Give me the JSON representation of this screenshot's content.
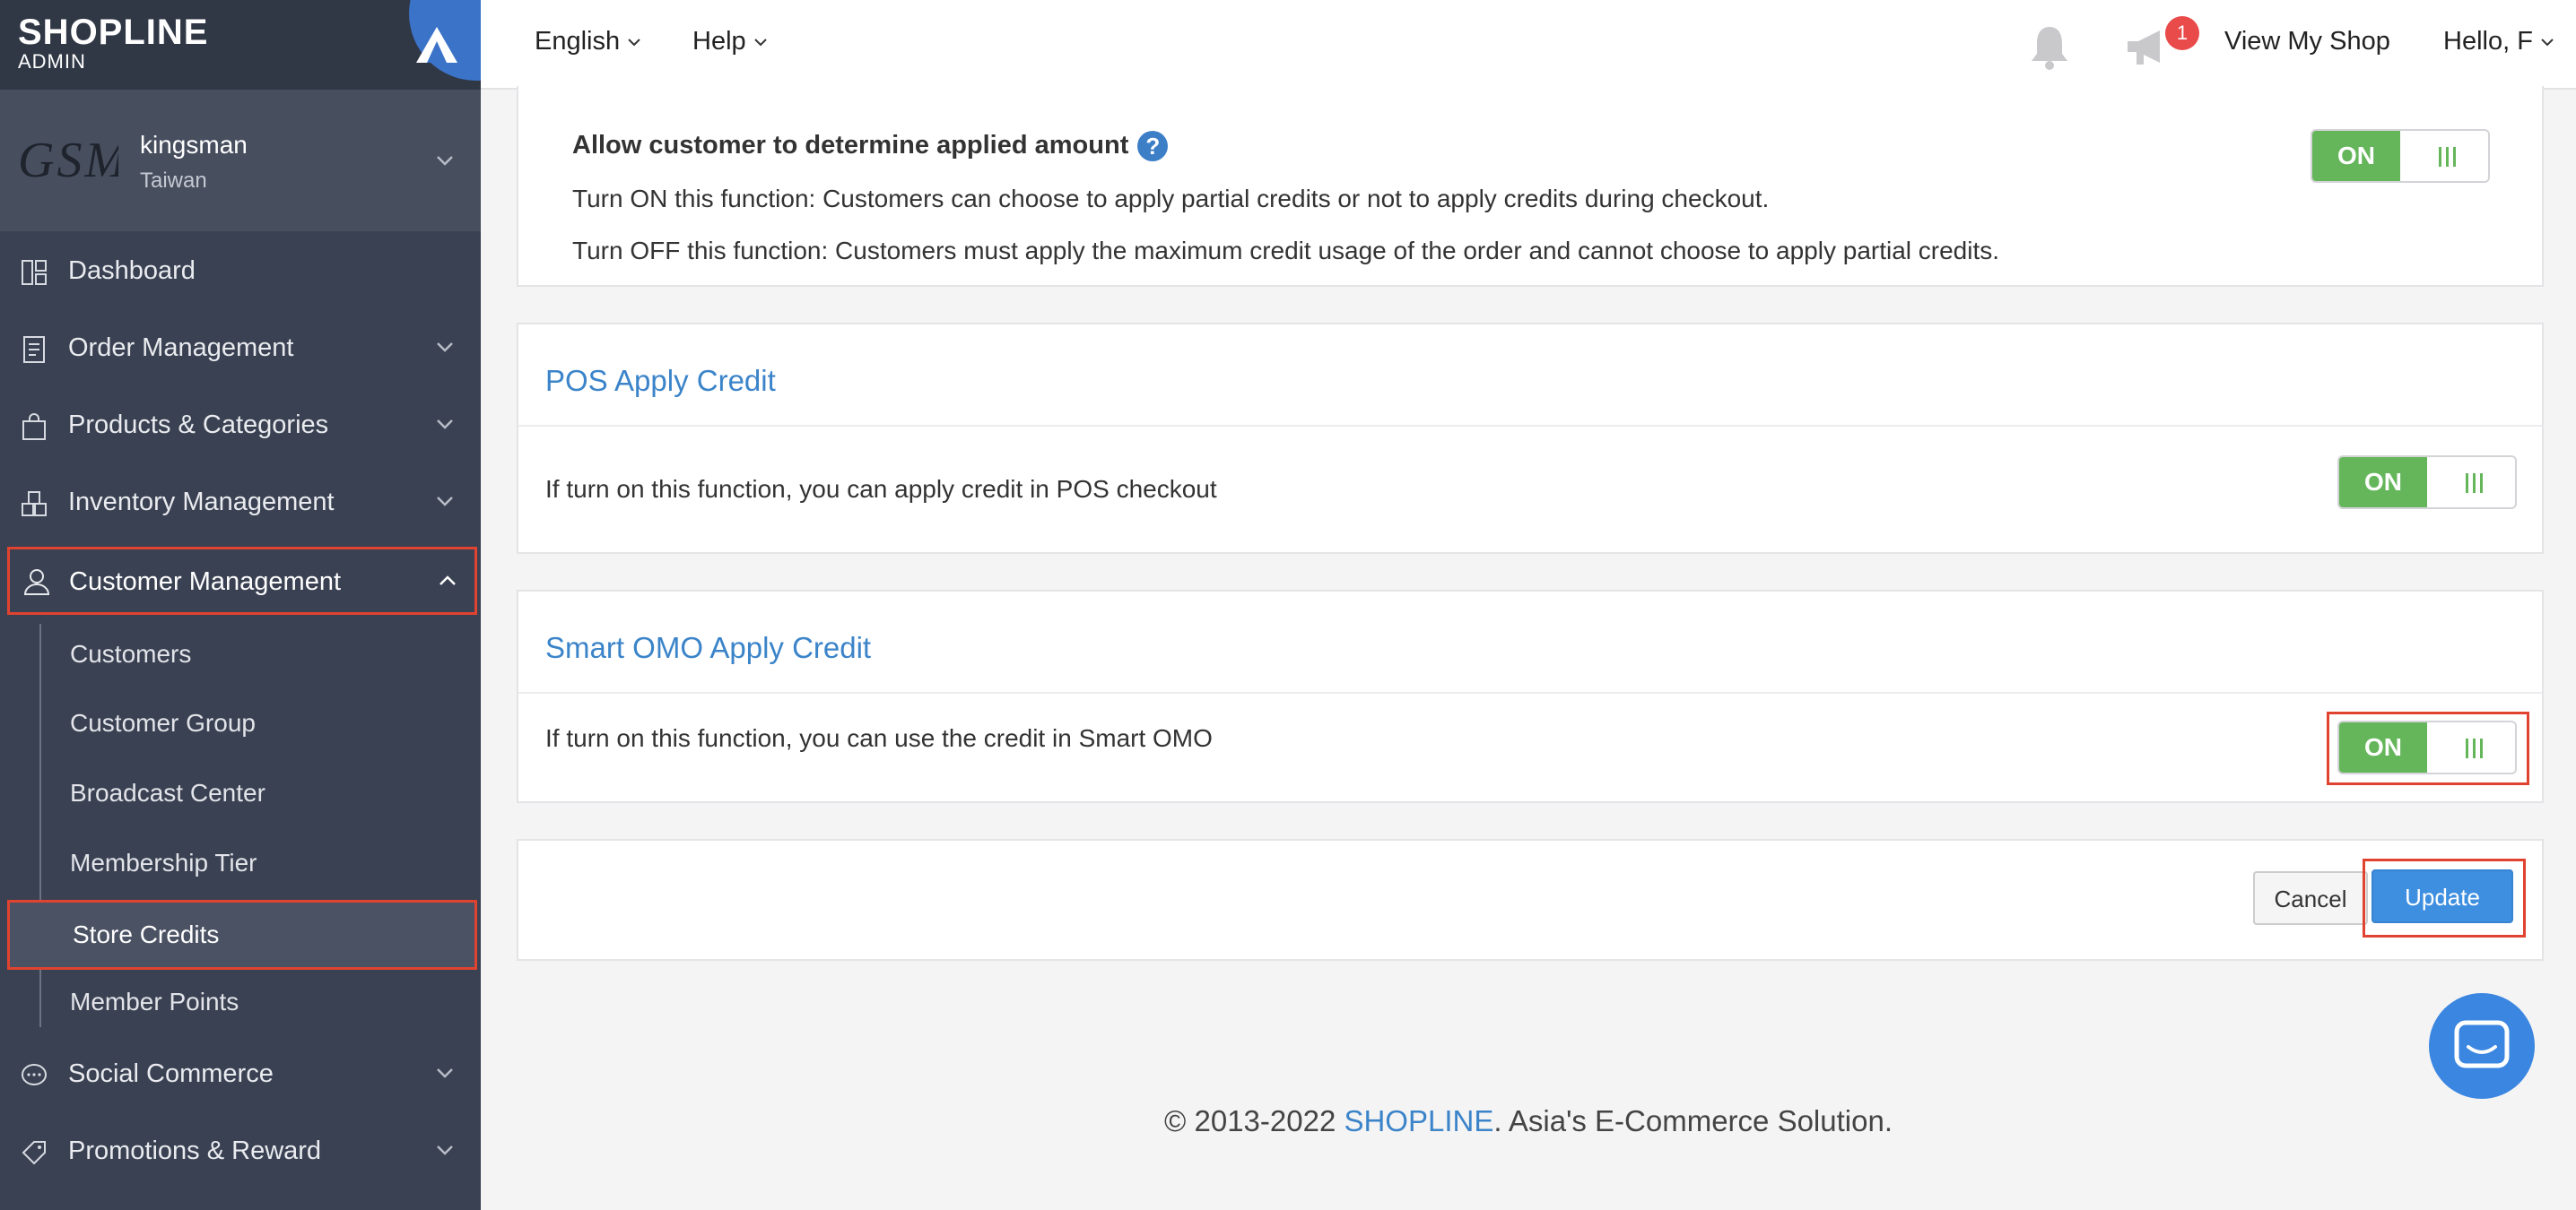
{
  "brand": {
    "logo": "SHOPLINE",
    "sub": "ADMIN"
  },
  "account": {
    "avatar_text": "GSM",
    "name": "kingsman",
    "country": "Taiwan"
  },
  "sidebar": {
    "items": [
      {
        "label": "Dashboard",
        "icon": "dashboard-icon"
      },
      {
        "label": "Order Management",
        "icon": "order-icon"
      },
      {
        "label": "Products & Categories",
        "icon": "bag-icon"
      },
      {
        "label": "Inventory Management",
        "icon": "boxes-icon"
      },
      {
        "label": "Customer Management",
        "icon": "person-icon"
      },
      {
        "label": "Social Commerce",
        "icon": "chat-bubble-icon"
      },
      {
        "label": "Promotions & Reward",
        "icon": "tag-icon"
      }
    ],
    "sub_items": [
      {
        "label": "Customers"
      },
      {
        "label": "Customer Group"
      },
      {
        "label": "Broadcast Center"
      },
      {
        "label": "Membership Tier"
      },
      {
        "label": "Store Credits"
      },
      {
        "label": "Member Points"
      }
    ]
  },
  "header": {
    "language": "English",
    "help": "Help",
    "notification_count": "1",
    "view_shop": "View My Shop",
    "greeting": "Hello, F"
  },
  "sections": {
    "apply_amount": {
      "title": "Allow customer to determine applied amount",
      "line1": "Turn ON this function: Customers can choose to apply partial credits or not to apply credits during checkout.",
      "line2": "Turn OFF this function: Customers must apply the maximum credit usage of the order and cannot choose to apply partial credits.",
      "toggle": "ON"
    },
    "pos": {
      "title": "POS Apply Credit",
      "desc": "If turn on this function, you can apply credit in POS checkout",
      "toggle": "ON"
    },
    "omo": {
      "title": "Smart OMO Apply Credit",
      "desc": "If turn on this function, you can use the credit in Smart OMO",
      "toggle": "ON"
    }
  },
  "actions": {
    "cancel": "Cancel",
    "update": "Update"
  },
  "footer": {
    "prefix": "© 2013-2022 ",
    "brand": "SHOPLINE",
    "suffix": ". Asia's E-Commerce Solution."
  },
  "colors": {
    "accent": "#3b84c9",
    "toggle_on": "#65b65b",
    "highlight": "#e0432f",
    "sidebar": "#3a4152"
  }
}
